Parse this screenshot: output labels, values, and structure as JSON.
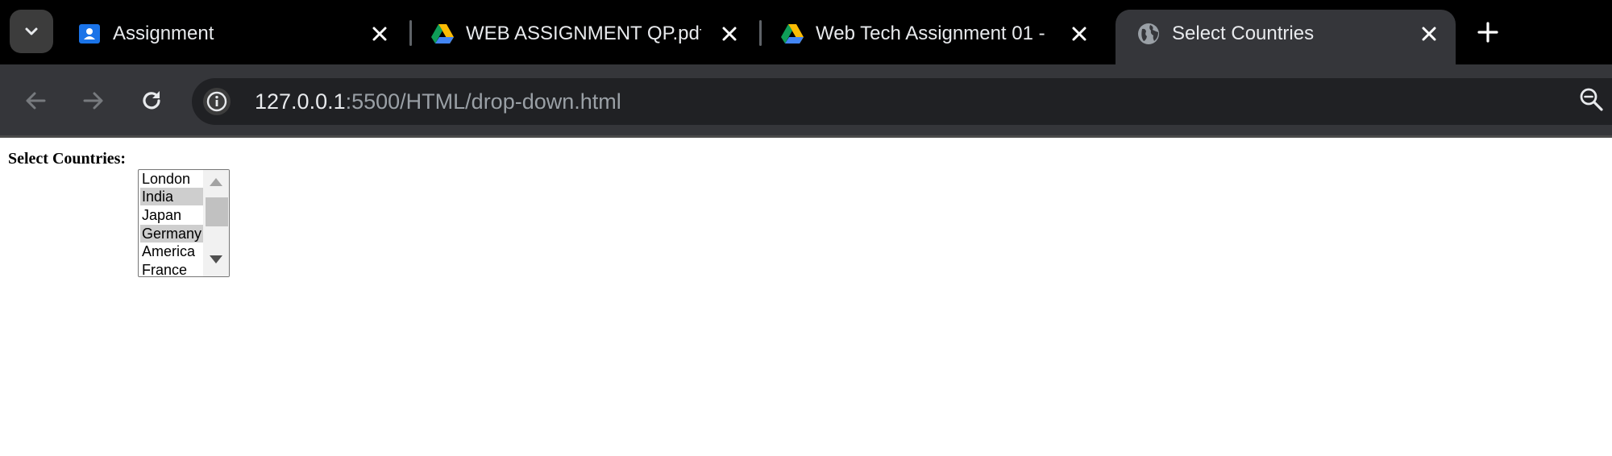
{
  "browser": {
    "tabs": [
      {
        "title": "Assignment",
        "favicon": "google-classroom-icon",
        "active": false
      },
      {
        "title": "WEB ASSIGNMENT QP.pdf -",
        "favicon": "google-drive-icon",
        "active": false
      },
      {
        "title": "Web Tech Assignment 01 - (",
        "favicon": "google-drive-icon",
        "active": false
      },
      {
        "title": "Select Countries",
        "favicon": "globe-icon",
        "active": true
      }
    ],
    "address": {
      "host": "127.0.0.1",
      "path": ":5500/HTML/drop-down.html"
    }
  },
  "page": {
    "label": "Select Countries:",
    "countries": [
      {
        "name": "London",
        "selected": false
      },
      {
        "name": "India",
        "selected": true
      },
      {
        "name": "Japan",
        "selected": false
      },
      {
        "name": "Germany",
        "selected": true
      },
      {
        "name": "America",
        "selected": false
      },
      {
        "name": "France",
        "selected": false
      }
    ]
  },
  "colors": {
    "tabstrip": "#000000",
    "toolbar": "#35363a",
    "omnibox": "#202124",
    "selected_option": "#cecece"
  }
}
